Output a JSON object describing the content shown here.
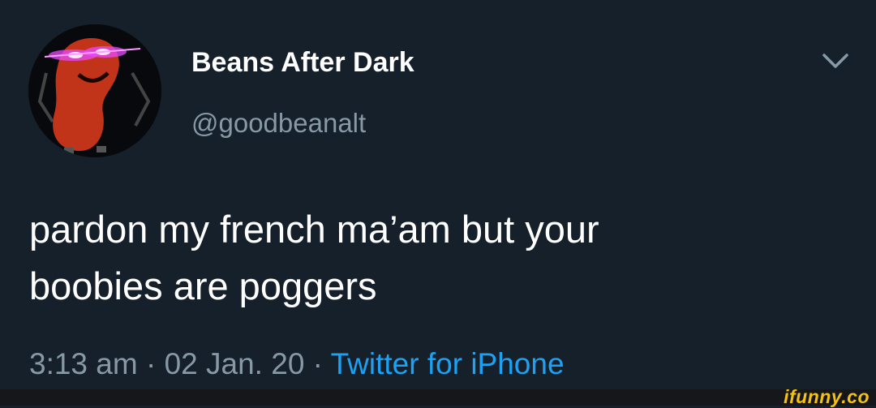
{
  "tweet": {
    "display_name": "Beans After Dark",
    "handle": "@goodbeanalt",
    "text_line1": "pardon my french ma’am but your",
    "text_line2": "boobies are poggers",
    "time": "3:13 am",
    "sep1": " · ",
    "date": "02 Jan. 20",
    "sep2": " · ",
    "source": "Twitter for iPhone",
    "avatar_icon": "bean-character-avatar",
    "menu_icon": "chevron-down-icon"
  },
  "watermark": {
    "text": "ifunny.co"
  },
  "colors": {
    "background": "#15202b",
    "name": "#ffffff",
    "secondary": "#8899a6",
    "link": "#1da1f2",
    "watermark": "#f5c211"
  }
}
